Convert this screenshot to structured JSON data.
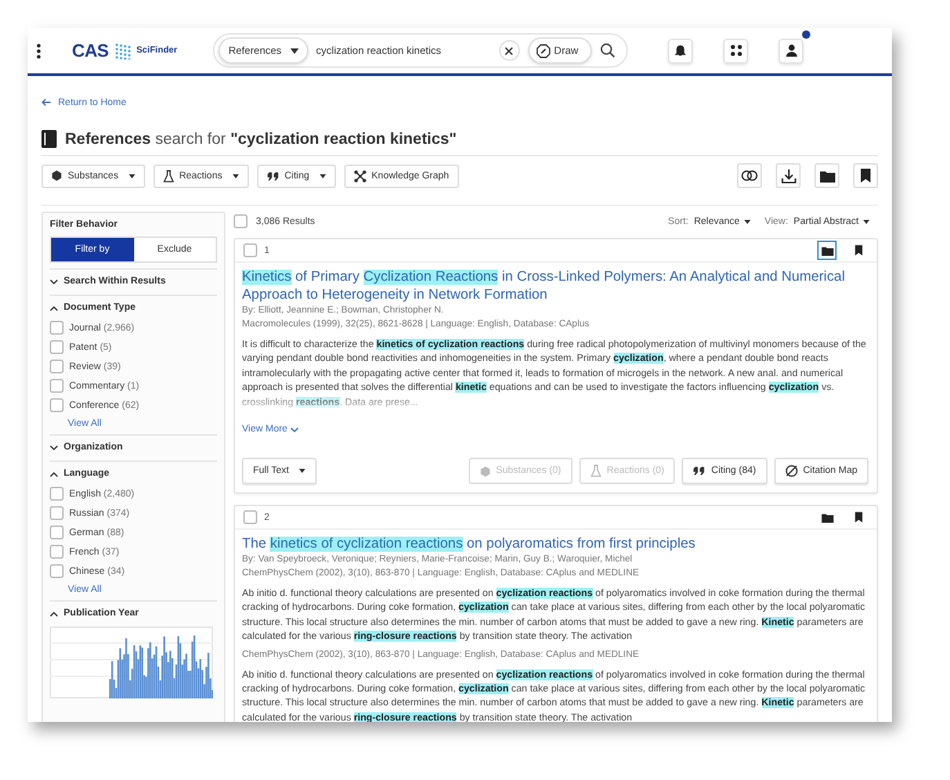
{
  "header": {
    "logo": "CAS",
    "product": "SciFinder",
    "search_type": "References",
    "query": "cyclization reaction kinetics",
    "draw_label": "Draw"
  },
  "back_link": "Return to Home",
  "page_title": {
    "type": "References",
    "middle": "search for",
    "query": "\"cyclization reaction kinetics\""
  },
  "toolbar": [
    {
      "label": "Substances",
      "kind": "substances",
      "dropdown": true
    },
    {
      "label": "Reactions",
      "kind": "reactions",
      "dropdown": true
    },
    {
      "label": "Citing",
      "kind": "citing",
      "dropdown": true
    },
    {
      "label": "Knowledge Graph",
      "kind": "graph",
      "dropdown": false
    }
  ],
  "filters": {
    "title": "Filter Behavior",
    "modes": [
      {
        "label": "Filter by",
        "selected": true
      },
      {
        "label": "Exclude",
        "selected": false
      }
    ],
    "sections": [
      {
        "title": "Search Within Results",
        "expanded": false
      },
      {
        "title": "Document Type",
        "expanded": true,
        "options": [
          {
            "label": "Journal",
            "count": "(2,966)",
            "checked": false
          },
          {
            "label": "Patent",
            "count": "(5)",
            "checked": false
          },
          {
            "label": "Review",
            "count": "(39)",
            "checked": false
          },
          {
            "label": "Commentary",
            "count": "(1)",
            "checked": false
          },
          {
            "label": "Conference",
            "count": "(62)",
            "checked": false
          }
        ],
        "view_all": "View All"
      },
      {
        "title": "Organization",
        "expanded": false
      },
      {
        "title": "Language",
        "expanded": true,
        "options": [
          {
            "label": "English",
            "count": "(2,480)",
            "checked": false
          },
          {
            "label": "Russian",
            "count": "(374)",
            "checked": false
          },
          {
            "label": "German",
            "count": "(88)",
            "checked": false
          },
          {
            "label": "French",
            "count": "(37)",
            "checked": false
          },
          {
            "label": "Chinese",
            "count": "(34)",
            "checked": false
          }
        ],
        "view_all": "View All"
      },
      {
        "title": "Publication Year",
        "expanded": true,
        "kind": "histogram"
      }
    ]
  },
  "results": {
    "count": "3,086 Results",
    "checked": false,
    "sort_label": "Sort:",
    "sort_value": "Relevance",
    "view_label": "View:",
    "view_value": "Partial Abstract",
    "items": [
      {
        "number": "1",
        "checked": false,
        "folder_focused": true,
        "title": [
          {
            "text": "Kinetics",
            "highlight": true
          },
          {
            "text": " of Primary ",
            "highlight": false
          },
          {
            "text": "Cyclization Reactions",
            "highlight": true
          },
          {
            "text": " in Cross-Linked Polymers: An Analytical and Numerical Approach to Heterogeneity in Network Formation",
            "highlight": false
          }
        ],
        "authors": "By: Elliott, Jeannine E.; Bowman, Christopher N.",
        "blocks": [
          {
            "source": "Macromolecules (1999), 32(25), 8621-8628 | Language: English, Database: CAplus",
            "truncated": true,
            "abstract": [
              {
                "text": "It is difficult to characterize the ",
                "highlight": false
              },
              {
                "text": "kinetics of cyclization ",
                "highlight": true
              },
              {
                "text": "reactions",
                "highlight": true
              },
              {
                "text": " during free radical photopolymerization of multivinyl monomers because of the varying pendant double bond reactivities and inhomogeneities in the system. Primary ",
                "highlight": false
              },
              {
                "text": "cyclization",
                "highlight": true
              },
              {
                "text": ", where a pendant double bond reacts intramolecularly with the propagating active center that formed it, leads to formation of microgels in the network. A new anal. and numerical approach is presented that solves the differential ",
                "highlight": false
              },
              {
                "text": "kinetic",
                "highlight": true
              },
              {
                "text": " equations and can be used to investigate the factors influencing ",
                "highlight": false
              },
              {
                "text": "cyclization",
                "highlight": true
              },
              {
                "text": " vs. crosslinking ",
                "highlight": false
              },
              {
                "text": "reactions",
                "highlight": true
              },
              {
                "text": ". Data are prese...",
                "highlight": false
              }
            ]
          }
        ],
        "view_more": "View More",
        "actions": [
          {
            "label": "Full Text",
            "kind": "fulltext",
            "disabled": false
          },
          {
            "label": "Substances (0)",
            "kind": "substances",
            "disabled": true
          },
          {
            "label": "Reactions (0)",
            "kind": "reactions",
            "disabled": true
          },
          {
            "label": "Citing (84)",
            "kind": "citing",
            "disabled": false
          },
          {
            "label": "Citation Map",
            "kind": "map",
            "disabled": false
          }
        ]
      },
      {
        "number": "2",
        "checked": false,
        "folder_focused": false,
        "title": [
          {
            "text": "The ",
            "highlight": false
          },
          {
            "text": "kinetics of cyclization ",
            "highlight": true
          },
          {
            "text": "reactions",
            "highlight": true
          },
          {
            "text": " on polyaromatics from first principles",
            "highlight": false
          }
        ],
        "authors": "By: Van Speybroeck, Veronique; Reyniers, Marie-Francoise; Marin, Guy B.; Waroquier, Michel",
        "blocks": [
          {
            "source": "ChemPhysChem (2002), 3(10), 863-870 | Language: English, Database: CAplus and MEDLINE",
            "truncated": false,
            "abstract": [
              {
                "text": "Ab initio d. functional theory calculations are presented on ",
                "highlight": false
              },
              {
                "text": "cyclization reactions",
                "highlight": true
              },
              {
                "text": " of polyaromatics involved in coke formation during the thermal cracking of hydrocarbons. During coke formation, ",
                "highlight": false
              },
              {
                "text": "cyclization",
                "highlight": true
              },
              {
                "text": " can take place at various sites, differing from each other by the local polyaromatic structure. This local structure also determines the min. number of carbon atoms that must be added to gave a new ring. ",
                "highlight": false
              },
              {
                "text": "Kinetic",
                "highlight": true
              },
              {
                "text": " parameters are calculated for the various ",
                "highlight": false
              },
              {
                "text": "ring-closure reactions",
                "highlight": true
              },
              {
                "text": " by transition state theory. The activation",
                "highlight": false
              }
            ]
          },
          {
            "source": "ChemPhysChem (2002), 3(10), 863-870 | Language: English, Database: CAplus and MEDLINE",
            "truncated": false,
            "abstract": [
              {
                "text": "Ab initio d. functional theory calculations are presented on ",
                "highlight": false
              },
              {
                "text": "cyclization reactions",
                "highlight": true
              },
              {
                "text": " of polyaromatics involved in coke formation during the thermal cracking of hydrocarbons. During coke formation, ",
                "highlight": false
              },
              {
                "text": "cyclization",
                "highlight": true
              },
              {
                "text": " can take place at various sites, differing from each other by the local polyaromatic structure. This local structure also determines the min. number of carbon atoms that must be added to gave a new ring. ",
                "highlight": false
              },
              {
                "text": "Kinetic",
                "highlight": true
              },
              {
                "text": " parameters are calculated for the various ",
                "highlight": false
              },
              {
                "text": "ring-closure reactions",
                "highlight": true
              },
              {
                "text": " by transition state theory. The activation",
                "highlight": false
              }
            ]
          }
        ]
      }
    ]
  }
}
